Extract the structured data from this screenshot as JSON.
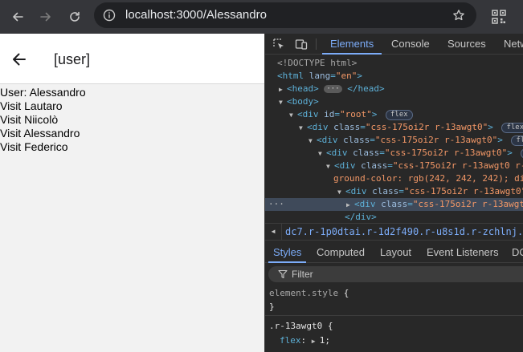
{
  "browser": {
    "url": "localhost:3000/Alessandro"
  },
  "app": {
    "title": "[user]",
    "lines": [
      "User: Alessandro",
      "Visit Lautaro",
      "Visit Niicolò",
      "Visit Alessandro",
      "Visit Federico"
    ]
  },
  "devtools": {
    "tabs": [
      "Elements",
      "Console",
      "Sources",
      "Netw"
    ],
    "dom": {
      "doctype": "<!DOCTYPE html>",
      "html_open": "<html",
      "lang_attr": "lang",
      "lang_value": "\"en\"",
      "head": "<head>",
      "head_close": "</head>",
      "head_ellipsis": "···",
      "body": "<body>",
      "div": "<div",
      "id_attr": "id",
      "id_value": "\"root\"",
      "class_attr": "class",
      "class_value": "\"css-175oi2r r-13awgt0\"",
      "class_value_long": "\"css-175oi2r r-13awgt0 r-1d5kdc",
      "style_continuation": "ground-color: rgb(242, 242, 242); display: no",
      "div_close": "</div>",
      "tag_end": ">",
      "badge_flex": "flex",
      "badge_flex_cut": "fle",
      "selected_dots": "···"
    },
    "breadcrumb": "dc7.r-1p0dtai.r-1d2f490.r-u8s1d.r-zchlnj.r-ipm5af",
    "styles_tabs": [
      "Styles",
      "Computed",
      "Layout",
      "Event Listeners",
      "DO"
    ],
    "filter_placeholder": "Filter",
    "styles": {
      "element_style_selector": "element.style",
      "open_brace": " {",
      "close_brace": "}",
      "rule_selector": ".r-13awgt0",
      "prop_name": "flex",
      "prop_value": "1;"
    }
  }
}
